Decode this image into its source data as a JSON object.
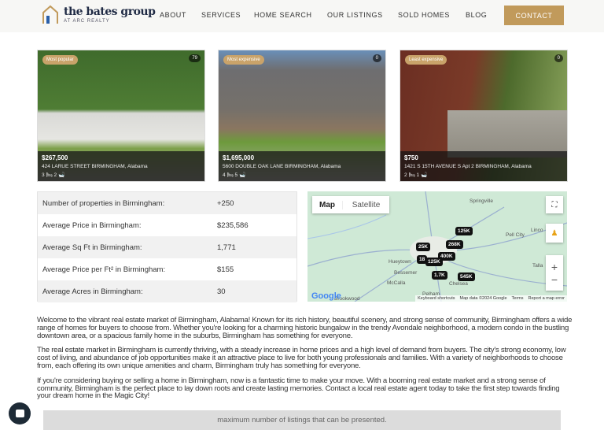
{
  "header": {
    "logo_title": "the bates group",
    "logo_subtitle": "AT ARC REALTY",
    "nav": [
      "ABOUT",
      "SERVICES",
      "HOME SEARCH",
      "OUR LISTINGS",
      "SOLD HOMES",
      "BLOG"
    ],
    "contact": "CONTACT"
  },
  "listings": [
    {
      "badge": "Most popular",
      "views": "79",
      "price": "$267,500",
      "address": "424 LARUE STREET BIRMINGHAM, Alabama",
      "beds": "3",
      "baths": "2"
    },
    {
      "badge": "Most expensive",
      "views": "0",
      "price": "$1,695,000",
      "address": "5600 DOUBLE OAK LANE BIRMINGHAM, Alabama",
      "beds": "4",
      "baths": "5"
    },
    {
      "badge": "Least expensive",
      "views": "0",
      "price": "$750",
      "address": "1421 S 15TH AVENUE S Apt 2 BIRMINGHAM, Alabama",
      "beds": "2",
      "baths": "1"
    }
  ],
  "stats": [
    {
      "label": "Number of properties in Birmingham:",
      "value": "+250"
    },
    {
      "label": "Average Price in Birmingham:",
      "value": "$235,586"
    },
    {
      "label": "Average Sq Ft in Birmingham:",
      "value": "1,771"
    },
    {
      "label": "Average Price per Ft² in Birmingham:",
      "value": "$155"
    },
    {
      "label": "Average Acres in Birmingham:",
      "value": "30"
    }
  ],
  "map": {
    "map_tab": "Map",
    "satellite_tab": "Satellite",
    "places": [
      "Springville",
      "Pell City",
      "Linco",
      "Hueytown",
      "Bessemer",
      "McCalla",
      "Pelham",
      "Chelsea",
      "Brookwood",
      "Talla"
    ],
    "markers": [
      "125K",
      "268K",
      "25K",
      "400K",
      "125K",
      "18",
      "1.7K",
      "545K"
    ],
    "footer": [
      "Keyboard shortcuts",
      "Map data ©2024 Google",
      "Terms",
      "Report a map error"
    ],
    "logo": "Google"
  },
  "content": {
    "paragraphs": [
      "Welcome to the vibrant real estate market of Birmingham, Alabama! Known for its rich history, beautiful scenery, and strong sense of community, Birmingham offers a wide range of homes for buyers to choose from. Whether you're looking for a charming historic bungalow in the trendy Avondale neighborhood, a modern condo in the bustling downtown area, or a spacious family home in the suburbs, Birmingham has something for everyone.",
      "The real estate market in Birmingham is currently thriving, with a steady increase in home prices and a high level of demand from buyers. The city's strong economy, low cost of living, and abundance of job opportunities make it an attractive place to live for both young professionals and families. With a variety of neighborhoods to choose from, each offering its own unique amenities and charm, Birmingham truly has something for everyone.",
      "If you're considering buying or selling a home in Birmingham, now is a fantastic time to make your move. With a booming real estate market and a strong sense of community, Birmingham is the perfect place to lay down roots and create lasting memories. Contact a local real estate agent today to take the first step towards finding your dream home in the Magic City!"
    ],
    "notice": "maximum number of listings that can be presented."
  }
}
